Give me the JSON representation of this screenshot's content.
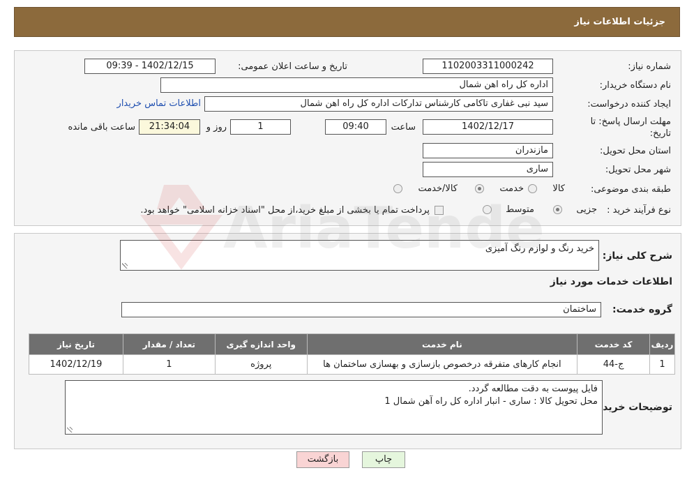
{
  "header": {
    "title": "جزئیات اطلاعات نیاز"
  },
  "form": {
    "need_number": {
      "label": "شماره نیاز:",
      "value": "1102003311000242"
    },
    "announce_datetime": {
      "label": "تاریخ و ساعت اعلان عمومی:",
      "value": "1402/12/15 - 09:39"
    },
    "buyer_org": {
      "label": "نام دستگاه خریدار:",
      "value": "اداره کل راه اهن شمال"
    },
    "requester": {
      "label": "ایجاد کننده درخواست:",
      "value": "سید نبی غفاری تاکامی کارشناس تدارکات اداره کل راه اهن شمال",
      "contact_link": "اطلاعات تماس خریدار"
    },
    "deadline": {
      "label_line1": "مهلت ارسال پاسخ: تا",
      "label_line2": "تاریخ:",
      "date": "1402/12/17",
      "time_label": "ساعت",
      "time": "09:40",
      "days": "1",
      "days_label": "روز و",
      "remaining": "21:34:04",
      "remaining_label": "ساعت باقی مانده"
    },
    "delivery_province": {
      "label": "استان محل تحویل:",
      "value": "مازندران"
    },
    "delivery_city": {
      "label": "شهر محل تحویل:",
      "value": "ساری"
    },
    "category": {
      "label": "طبقه بندی موضوعی:",
      "options": [
        {
          "label": "کالا",
          "checked": false
        },
        {
          "label": "خدمت",
          "checked": true
        },
        {
          "label": "کالا/خدمت",
          "checked": false
        }
      ]
    },
    "purchase_process": {
      "label": "نوع فرآیند خرید :",
      "options": [
        {
          "label": "جزیی",
          "checked": true
        },
        {
          "label": "متوسط",
          "checked": false
        }
      ],
      "payment_note": "پرداخت تمام یا بخشی از مبلغ خرید،از محل \"اسناد خزانه اسلامی\" خواهد بود."
    }
  },
  "details": {
    "summary_label": "شرح کلی نیاز:",
    "summary_value": "خرید رنگ و لوازم رنگ آمیزی",
    "services_heading": "اطلاعات خدمات مورد نیاز",
    "service_group_label": "گروه خدمت:",
    "service_group_value": "ساختمان",
    "table": {
      "headers": [
        "ردیف",
        "کد خدمت",
        "نام خدمت",
        "واحد اندازه گیری",
        "تعداد / مقدار",
        "تاریخ نیاز"
      ],
      "rows": [
        [
          "1",
          "ج-44",
          "انجام کارهای متفرقه درخصوص بازسازی و بهسازی ساختمان ها",
          "پروژه",
          "1",
          "1402/12/19"
        ]
      ]
    },
    "buyer_notes_label": "توضیحات خریدار:",
    "buyer_notes_lines": [
      "فایل پیوست به دقت مطالعه گردد.",
      "محل تحویل کالا : ساری - انبار اداره کل راه آهن شمال 1"
    ]
  },
  "buttons": {
    "print": "چاپ",
    "back": "بازگشت"
  },
  "watermark": {
    "text": "AriaTender.neT"
  }
}
